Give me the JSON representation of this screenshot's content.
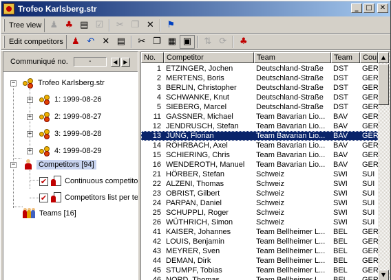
{
  "window": {
    "title": "Trofeo Karlsberg.str"
  },
  "toolbar1": {
    "label": "Tree view"
  },
  "toolbar2": {
    "label": "Edit competitors"
  },
  "communique": {
    "label": "Communiqué no.",
    "value": "-"
  },
  "tree": {
    "root": "Trofeo Karlsberg.str",
    "days": [
      "1: 1999-08-26",
      "2: 1999-08-27",
      "3: 1999-08-28",
      "4: 1999-08-29"
    ],
    "competitors": "Competitors [94]",
    "reports": [
      "Continuous competitors",
      "Competitors list per team"
    ],
    "teams": "Teams [16]"
  },
  "table": {
    "columns": [
      "No.",
      "Competitor",
      "Team",
      "Team",
      "Cou"
    ],
    "rows": [
      [
        "1",
        "ETZINGER, Jochen",
        "Deutschland-Straße",
        "DST",
        "GER"
      ],
      [
        "2",
        "MERTENS, Boris",
        "Deutschland-Straße",
        "DST",
        "GER"
      ],
      [
        "3",
        "BERLIN, Christopher",
        "Deutschland-Straße",
        "DST",
        "GER"
      ],
      [
        "4",
        "SCHWANKE, Knut",
        "Deutschland-Straße",
        "DST",
        "GER"
      ],
      [
        "5",
        "SIEBERG, Marcel",
        "Deutschland-Straße",
        "DST",
        "GER"
      ],
      [
        "11",
        "GASSNER, Michael",
        "Team Bavarian Lio...",
        "BAV",
        "GER"
      ],
      [
        "12",
        "JENDRUSCH, Stefan",
        "Team Bavarian Lio...",
        "BAV",
        "GER"
      ],
      [
        "13",
        "JUNG, Florian",
        "Team Bavarian Lio...",
        "BAV",
        "GER"
      ],
      [
        "14",
        "RÖHRBACH, Axel",
        "Team Bavarian Lio...",
        "BAV",
        "GER"
      ],
      [
        "15",
        "SCHIERING, Chris",
        "Team Bavarian Lio...",
        "BAV",
        "GER"
      ],
      [
        "16",
        "WENDEROTH, Manuel",
        "Team Bavarian Lio...",
        "BAV",
        "GER"
      ],
      [
        "21",
        "HÖRBER, Stefan",
        "Schweiz",
        "SWI",
        "SUI"
      ],
      [
        "22",
        "ALZENI, Thomas",
        "Schweiz",
        "SWI",
        "SUI"
      ],
      [
        "23",
        "OBRIST, Gilbert",
        "Schweiz",
        "SWI",
        "SUI"
      ],
      [
        "24",
        "PARPAN, Daniel",
        "Schweiz",
        "SWI",
        "SUI"
      ],
      [
        "25",
        "SCHUPPLI, Roger",
        "Schweiz",
        "SWI",
        "SUI"
      ],
      [
        "26",
        "WÜTHRICH, Simon",
        "Schweiz",
        "SWI",
        "SUI"
      ],
      [
        "41",
        "KAISER, Johannes",
        "Team Bellheimer L...",
        "BEL",
        "GER"
      ],
      [
        "42",
        "LOUIS, Benjamin",
        "Team Bellheimer L...",
        "BEL",
        "GER"
      ],
      [
        "43",
        "MEYRER, Sven",
        "Team Bellheimer L...",
        "BEL",
        "GER"
      ],
      [
        "44",
        "DEMAN, Dirk",
        "Team Bellheimer L...",
        "BEL",
        "GER"
      ],
      [
        "45",
        "STUMPF, Tobias",
        "Team Bellheimer L...",
        "BEL",
        "GER"
      ],
      [
        "46",
        "NORD, Thomas",
        "Team Bellheimer L...",
        "BEL",
        "GER"
      ]
    ],
    "selected_row": 7
  }
}
